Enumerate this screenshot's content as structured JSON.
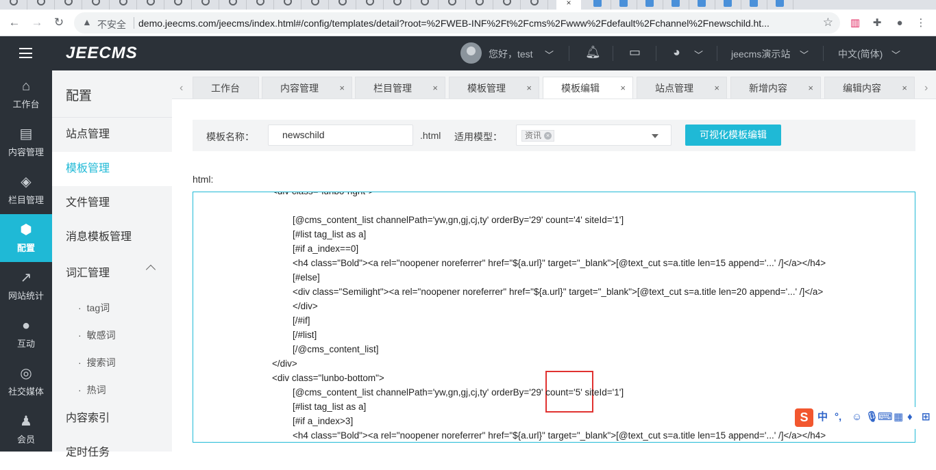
{
  "browser": {
    "active_tab_close": "×",
    "insecure_label": "不安全",
    "url": "demo.jeecms.com/jeecms/index.html#/config/templates/detail?root=%2FWEB-INF%2Ft%2Fcms%2Fwww%2Fdefault%2Fchannel%2Fnewschild.ht..."
  },
  "header": {
    "logo": "JEECMS",
    "greeting": "您好，test",
    "site": "jeecms演示站",
    "language": "中文(简体)"
  },
  "iconnav": [
    {
      "label": "工作台",
      "icon": "home-icon"
    },
    {
      "label": "内容管理",
      "icon": "document-icon"
    },
    {
      "label": "栏目管理",
      "icon": "layers-icon"
    },
    {
      "label": "配置",
      "icon": "cube-icon",
      "active": true
    },
    {
      "label": "网站统计",
      "icon": "chart-icon"
    },
    {
      "label": "互动",
      "icon": "chat-icon"
    },
    {
      "label": "社交媒体",
      "icon": "target-icon"
    },
    {
      "label": "会员",
      "icon": "user-icon"
    }
  ],
  "submenu": {
    "title": "配置",
    "items": [
      "站点管理",
      "模板管理",
      "文件管理",
      "消息模板管理",
      "词汇管理"
    ],
    "children": [
      "tag词",
      "敏感词",
      "搜索词",
      "热词"
    ],
    "more": [
      "内容索引",
      "定时任务"
    ]
  },
  "tabs": [
    {
      "label": "工作台"
    },
    {
      "label": "内容管理",
      "close": "×"
    },
    {
      "label": "栏目管理",
      "close": "×"
    },
    {
      "label": "模板管理",
      "close": "×"
    },
    {
      "label": "模板编辑",
      "close": "×",
      "active": true
    },
    {
      "label": "站点管理",
      "close": "×"
    },
    {
      "label": "新增内容",
      "close": "×"
    },
    {
      "label": "编辑内容",
      "close": "×"
    }
  ],
  "form": {
    "name_label": "模板名称：",
    "name_value": "newschild",
    "ext": ".html",
    "model_label": "适用模型：",
    "model_chip": "资讯",
    "visual_button": "可视化模板编辑"
  },
  "editor": {
    "label": "html:",
    "lines": [
      "<div class=\"lunbo-right\">",
      "",
      "[@cms_content_list channelPath='yw,gn,gj,cj,ty' orderBy='29' count='4' siteId='1']",
      "[#list tag_list as a]",
      "[#if a_index==0]",
      "<h4 class=\"Bold\"><a rel=\"noopener noreferrer\" href=\"${a.url}\" target=\"_blank\">[@text_cut s=a.title len=15 append='...' /]</a></h4>",
      "[#else]",
      "<div class=\"Semilight\"><a rel=\"noopener noreferrer\" href=\"${a.url}\" target=\"_blank\">[@text_cut s=a.title len=20 append='...' /]</a>",
      "</div>",
      "[/#if]",
      "[/#list]",
      "[/@cms_content_list]",
      "</div>",
      "<div class=\"lunbo-bottom\">",
      "[@cms_content_list channelPath='yw,gn,gj,cj,ty' orderBy='29' count='5' siteId='1']",
      "[#list tag_list as a]",
      "[#if a_index>3]",
      "<h4 class=\"Bold\"><a rel=\"noopener noreferrer\" href=\"${a.url}\" target=\"_blank\">[@text_cut s=a.title len=15 append='...' /]</a></h4>"
    ]
  },
  "ime": {
    "logo": "S",
    "lang": "中"
  }
}
